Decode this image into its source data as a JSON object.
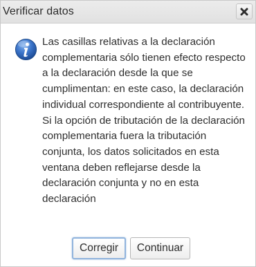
{
  "dialog": {
    "title": "Verificar datos",
    "close_icon": "close-icon",
    "info_icon": "info-icon",
    "message": "Las casillas relativas a la declaración complementaria sólo tienen efecto respecto a la declaración desde la que se cumplimentan: en este caso, la declaración individual correspondiente al contribuyente. Si la opción de tributación de la declaración complementaria fuera la tributación conjunta, los datos solicitados en esta ventana deben reflejarse desde la declaración conjunta y no en esta declaración",
    "buttons": {
      "primary_label": "Corregir",
      "secondary_label": "Continuar"
    },
    "colors": {
      "info_icon_blue": "#2f63b4",
      "focus_border": "#8fb3dc"
    }
  }
}
